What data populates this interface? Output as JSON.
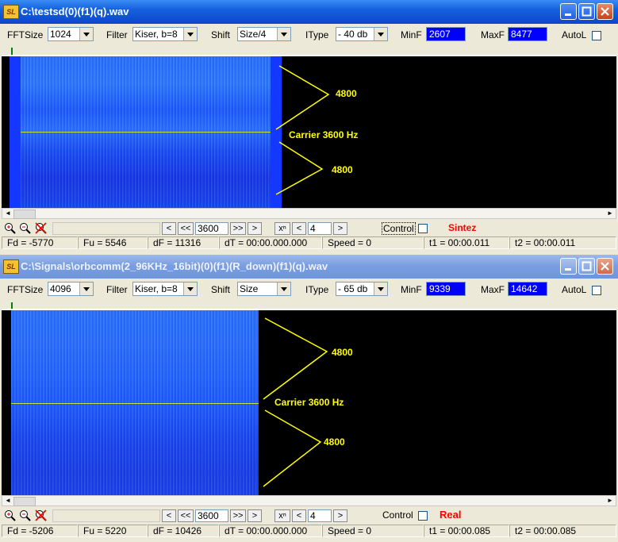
{
  "windows": [
    {
      "title": "C:\\testsd(0)(f1)(q).wav",
      "toolbar": {
        "fftsize_label": "FFTSize",
        "fftsize_value": "1024",
        "filter_label": "Filter",
        "filter_value": "Kiser, b=8",
        "shift_label": "Shift",
        "shift_value": "Size/4",
        "itype_label": "IType",
        "itype_value": "- 40 db",
        "minf_label": "MinF",
        "minf_value": "2607",
        "maxf_label": "MaxF",
        "maxf_value": "8477",
        "autol_label": "AutoL"
      },
      "annotations": {
        "upper": "4800",
        "carrier": "Carrier 3600 Hz",
        "lower": "4800"
      },
      "controls": {
        "btn_prev": "<",
        "btn_prev2": "<<",
        "step_value": "3600",
        "btn_next2": ">>",
        "btn_next": ">",
        "xn_label": "xⁿ",
        "btn_dec": "<",
        "exp_value": "4",
        "btn_inc": ">",
        "control_label": "Control",
        "mode_label": "Sintez"
      },
      "status": {
        "fd": "Fd = -5770",
        "fu": "Fu = 5546",
        "df": "dF = 11316",
        "dt": "dT = 00:00.000.000",
        "speed": "Speed = 0",
        "t1": "t1 = 00:00.011",
        "t2": "t2 = 00:00.011"
      }
    },
    {
      "title": "C:\\Signals\\orbcomm(2_96KHz_16bit)(0)(f1)(R_down)(f1)(q).wav",
      "toolbar": {
        "fftsize_label": "FFTSize",
        "fftsize_value": "4096",
        "filter_label": "Filter",
        "filter_value": "Kiser, b=8",
        "shift_label": "Shift",
        "shift_value": "Size",
        "itype_label": "IType",
        "itype_value": "- 65 db",
        "minf_label": "MinF",
        "minf_value": "9339",
        "maxf_label": "MaxF",
        "maxf_value": "14642",
        "autol_label": "AutoL"
      },
      "annotations": {
        "upper": "4800",
        "carrier": "Carrier 3600 Hz",
        "lower": "4800"
      },
      "controls": {
        "btn_prev": "<",
        "btn_prev2": "<<",
        "step_value": "3600",
        "btn_next2": ">>",
        "btn_next": ">",
        "xn_label": "xⁿ",
        "btn_dec": "<",
        "exp_value": "4",
        "btn_inc": ">",
        "control_label": "Control",
        "mode_label": "Real"
      },
      "status": {
        "fd": "Fd = -5206",
        "fu": "Fu = 5220",
        "df": "dF = 10426",
        "dt": "dT = 00:00.000.000",
        "speed": "Speed = 0",
        "t1": "t1 = 00:00.085",
        "t2": "t2 = 00:00.085"
      }
    }
  ],
  "colors": {
    "annotation": "#ffff00",
    "spectrogram": "#1a4bff",
    "mode_label": "#ff0000",
    "freq_box": "#0000ff"
  },
  "icons": [
    "app-icon",
    "minimize-icon",
    "maximize-icon",
    "close-icon",
    "zoom-in-icon",
    "zoom-out-icon",
    "no-zoom-icon"
  ]
}
